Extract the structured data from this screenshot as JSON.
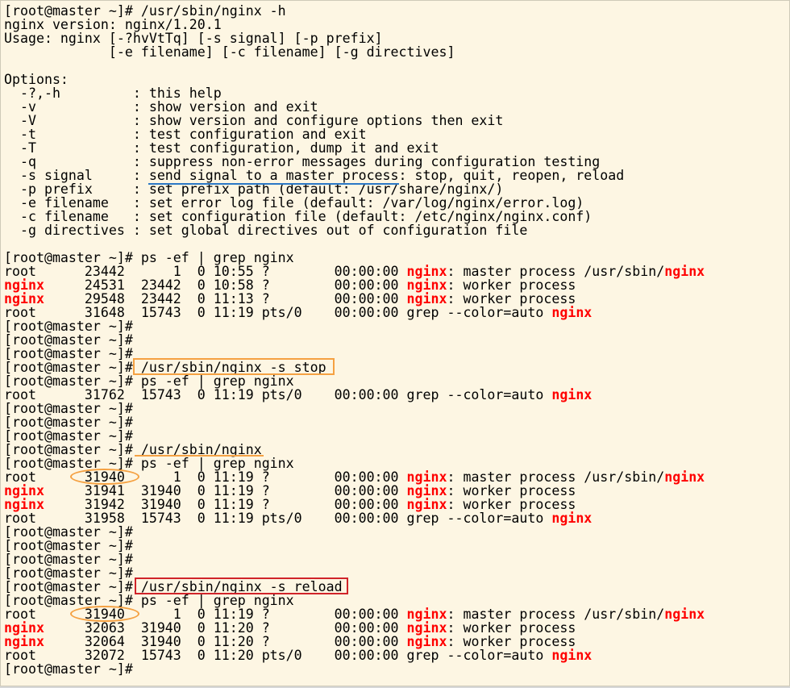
{
  "terminal": {
    "highlight_color": "#ff0000",
    "lines": [
      [
        {
          "t": "[root@master ~]# /usr/sbin/nginx -h"
        }
      ],
      [
        {
          "t": "nginx version: nginx/1.20.1"
        }
      ],
      [
        {
          "t": "Usage: nginx [-?hvVtTq] [-s signal] [-p prefix]"
        }
      ],
      [
        {
          "t": "             [-e filename] [-c filename] [-g directives]"
        }
      ],
      [
        {
          "t": ""
        }
      ],
      [
        {
          "t": "Options:"
        }
      ],
      [
        {
          "t": "  -?,-h         : this help"
        }
      ],
      [
        {
          "t": "  -v            : show version and exit"
        }
      ],
      [
        {
          "t": "  -V            : show version and configure options then exit"
        }
      ],
      [
        {
          "t": "  -t            : test configuration and exit"
        }
      ],
      [
        {
          "t": "  -T            : test configuration, dump it and exit"
        }
      ],
      [
        {
          "t": "  -q            : suppress non-error messages during configuration testing"
        }
      ],
      [
        {
          "t": "  -s signal     : send signal to a master process: stop, quit, reopen, reload"
        }
      ],
      [
        {
          "t": "  -p prefix     : set prefix path (default: /usr/share/nginx/)"
        }
      ],
      [
        {
          "t": "  -e filename   : set error log file (default: /var/log/nginx/error.log)"
        }
      ],
      [
        {
          "t": "  -c filename   : set configuration file (default: /etc/nginx/nginx.conf)"
        }
      ],
      [
        {
          "t": "  -g directives : set global directives out of configuration file"
        }
      ],
      [
        {
          "t": ""
        }
      ],
      [
        {
          "t": "[root@master ~]# ps -ef | grep nginx"
        }
      ],
      [
        {
          "t": "root      23442      1  0 10:55 ?        00:00:00 "
        },
        {
          "t": "nginx",
          "h": true
        },
        {
          "t": ": master process /usr/sbin/"
        },
        {
          "t": "nginx",
          "h": true
        }
      ],
      [
        {
          "t": "nginx",
          "h": true
        },
        {
          "t": "     24531  23442  0 10:58 ?        00:00:00 "
        },
        {
          "t": "nginx",
          "h": true
        },
        {
          "t": ": worker process"
        }
      ],
      [
        {
          "t": "nginx",
          "h": true
        },
        {
          "t": "     29548  23442  0 11:13 ?        00:00:00 "
        },
        {
          "t": "nginx",
          "h": true
        },
        {
          "t": ": worker process"
        }
      ],
      [
        {
          "t": "root      31648  15743  0 11:19 pts/0    00:00:00 grep --color=auto "
        },
        {
          "t": "nginx",
          "h": true
        }
      ],
      [
        {
          "t": "[root@master ~]#"
        }
      ],
      [
        {
          "t": "[root@master ~]#"
        }
      ],
      [
        {
          "t": "[root@master ~]#"
        }
      ],
      [
        {
          "t": "[root@master ~]# /usr/sbin/nginx -s stop"
        }
      ],
      [
        {
          "t": "[root@master ~]# ps -ef | grep nginx"
        }
      ],
      [
        {
          "t": "root      31762  15743  0 11:19 pts/0    00:00:00 grep --color=auto "
        },
        {
          "t": "nginx",
          "h": true
        }
      ],
      [
        {
          "t": "[root@master ~]#"
        }
      ],
      [
        {
          "t": "[root@master ~]#"
        }
      ],
      [
        {
          "t": "[root@master ~]#"
        }
      ],
      [
        {
          "t": "[root@master ~]# /usr/sbin/nginx"
        }
      ],
      [
        {
          "t": "[root@master ~]# ps -ef | grep nginx"
        }
      ],
      [
        {
          "t": "root      31940      1  0 11:19 ?        00:00:00 "
        },
        {
          "t": "nginx",
          "h": true
        },
        {
          "t": ": master process /usr/sbin/"
        },
        {
          "t": "nginx",
          "h": true
        }
      ],
      [
        {
          "t": "nginx",
          "h": true
        },
        {
          "t": "     31941  31940  0 11:19 ?        00:00:00 "
        },
        {
          "t": "nginx",
          "h": true
        },
        {
          "t": ": worker process"
        }
      ],
      [
        {
          "t": "nginx",
          "h": true
        },
        {
          "t": "     31942  31940  0 11:19 ?        00:00:00 "
        },
        {
          "t": "nginx",
          "h": true
        },
        {
          "t": ": worker process"
        }
      ],
      [
        {
          "t": "root      31958  15743  0 11:19 pts/0    00:00:00 grep --color=auto "
        },
        {
          "t": "nginx",
          "h": true
        }
      ],
      [
        {
          "t": "[root@master ~]#"
        }
      ],
      [
        {
          "t": "[root@master ~]#"
        }
      ],
      [
        {
          "t": "[root@master ~]#"
        }
      ],
      [
        {
          "t": "[root@master ~]#"
        }
      ],
      [
        {
          "t": "[root@master ~]# /usr/sbin/nginx -s reload"
        }
      ],
      [
        {
          "t": "[root@master ~]# ps -ef | grep nginx"
        }
      ],
      [
        {
          "t": "root      31940      1  0 11:19 ?        00:00:00 "
        },
        {
          "t": "nginx",
          "h": true
        },
        {
          "t": ": master process /usr/sbin/"
        },
        {
          "t": "nginx",
          "h": true
        }
      ],
      [
        {
          "t": "nginx",
          "h": true
        },
        {
          "t": "     32063  31940  0 11:20 ?        00:00:00 "
        },
        {
          "t": "nginx",
          "h": true
        },
        {
          "t": ": worker process"
        }
      ],
      [
        {
          "t": "nginx",
          "h": true
        },
        {
          "t": "     32064  31940  0 11:20 ?        00:00:00 "
        },
        {
          "t": "nginx",
          "h": true
        },
        {
          "t": ": worker process"
        }
      ],
      [
        {
          "t": "root      32072  15743  0 11:20 pts/0    00:00:00 grep --color=auto "
        },
        {
          "t": "nginx",
          "h": true
        }
      ],
      [
        {
          "t": "[root@master ~]#"
        }
      ]
    ]
  }
}
